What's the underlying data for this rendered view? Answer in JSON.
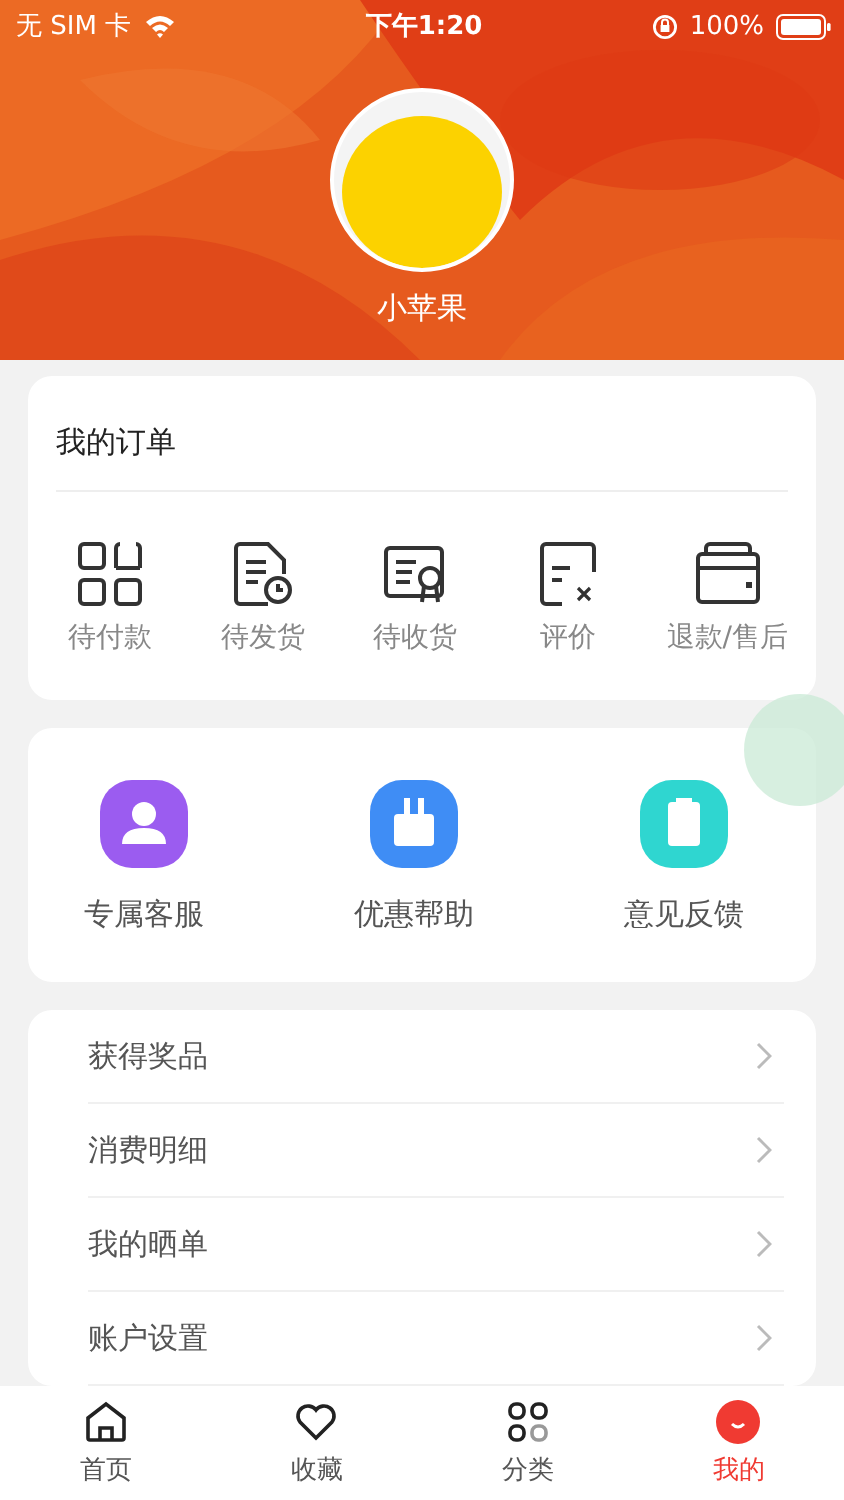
{
  "status_bar": {
    "carrier": "无 SIM 卡",
    "time": "下午1:20",
    "battery": "100%"
  },
  "profile": {
    "name": "小苹果"
  },
  "orders": {
    "title": "我的订单",
    "items": [
      {
        "kind": "grid",
        "label": "待付款"
      },
      {
        "kind": "doc-clock",
        "label": "待发货"
      },
      {
        "kind": "certificate",
        "label": "待收货"
      },
      {
        "kind": "review",
        "label": "评价"
      },
      {
        "kind": "wallet",
        "label": "退款/售后"
      }
    ]
  },
  "services": [
    {
      "kind": "person",
      "label": "专属客服",
      "color": "#9b5cf0"
    },
    {
      "kind": "bag",
      "label": "优惠帮助",
      "color": "#3f8df5"
    },
    {
      "kind": "clipboard",
      "label": "意见反馈",
      "color": "#2fd6d0"
    }
  ],
  "menu": [
    "获得奖品",
    "消费明细",
    "我的晒单",
    "账户设置"
  ],
  "tab_bar": [
    {
      "kind": "home",
      "label": "首页",
      "selected": false
    },
    {
      "kind": "heart",
      "label": "收藏",
      "selected": false
    },
    {
      "kind": "grid",
      "label": "分类",
      "selected": false
    },
    {
      "kind": "me",
      "label": "我的",
      "selected": true
    }
  ]
}
